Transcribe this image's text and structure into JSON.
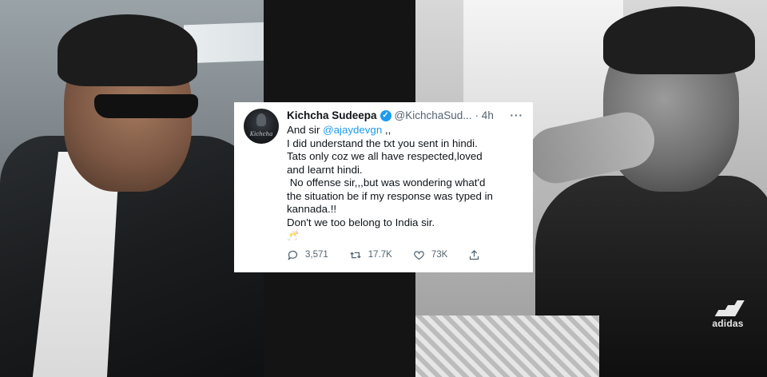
{
  "tweet": {
    "name": "Kichcha Sudeepa",
    "handle": "@KichchaSud...",
    "time": "· 4h",
    "more": "···",
    "avatar_signature": "Kichcha",
    "line1_prefix": "And sir ",
    "line1_mention": "@ajaydevgn",
    "line1_suffix": " ,,",
    "lines": [
      "I did understand the txt you sent in hindi.",
      "Tats only coz we all have respected,loved",
      "and learnt hindi.",
      " No offense sir,,,but was wondering what'd",
      "the situation be if my response was typed in",
      "kannada.!!",
      "Don't we too belong to India sir."
    ],
    "emoji": "🥂",
    "replies": "3,571",
    "retweets": "17.7K",
    "likes": "73K"
  },
  "photo_right": {
    "logo_text": "adidas"
  },
  "colors": {
    "link": "#1d9bf0",
    "verified": "#1d9bf0",
    "text": "#0f1419",
    "muted": "#536471"
  }
}
